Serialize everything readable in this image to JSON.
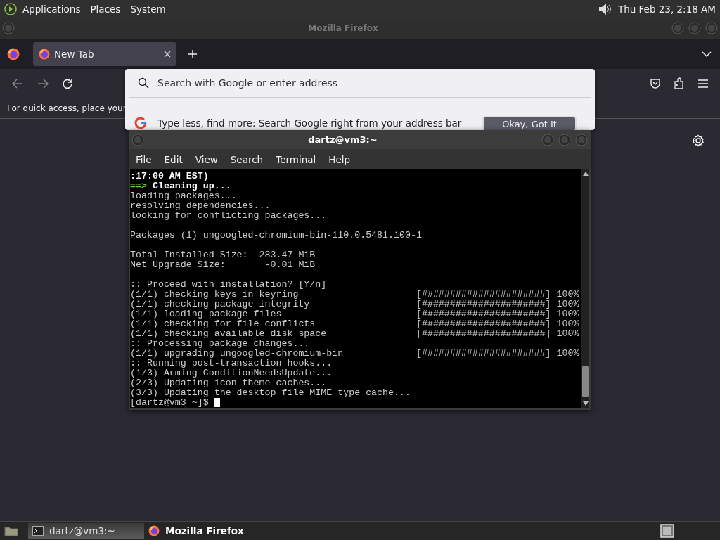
{
  "top_panel": {
    "menus": [
      "Applications",
      "Places",
      "System"
    ],
    "clock": "Thu Feb 23,  2:18 AM"
  },
  "firefox": {
    "title": "Mozilla Firefox",
    "tabs": [
      {
        "label": "New Tab",
        "selected": true
      }
    ],
    "bookmarks_hint": "For quick access, place your",
    "url_dropdown": {
      "placeholder": "Search with Google or enter address",
      "suggestion": "Type less, find more: Search Google right from your address bar",
      "button": "Okay, Got It"
    }
  },
  "terminal": {
    "title": "dartz@vm3:~",
    "menus": [
      "File",
      "Edit",
      "View",
      "Search",
      "Terminal",
      "Help"
    ],
    "lines": [
      {
        "kind": "bold",
        "text": ":17:00 AM EST)"
      },
      {
        "kind": "step",
        "arrow": "==>",
        "text": "Cleaning up..."
      },
      {
        "kind": "plain",
        "text": "loading packages..."
      },
      {
        "kind": "plain",
        "text": "resolving dependencies..."
      },
      {
        "kind": "plain",
        "text": "looking for conflicting packages..."
      },
      {
        "kind": "blank"
      },
      {
        "kind": "plain",
        "text": "Packages (1) ungoogled-chromium-bin-110.0.5481.100-1"
      },
      {
        "kind": "blank"
      },
      {
        "kind": "plain",
        "text": "Total Installed Size:  283.47 MiB"
      },
      {
        "kind": "plain",
        "text": "Net Upgrade Size:       -0.01 MiB"
      },
      {
        "kind": "blank"
      },
      {
        "kind": "plain",
        "text": ":: Proceed with installation? [Y/n]"
      },
      {
        "kind": "progress",
        "text": "(1/1) checking keys in keyring",
        "bar": "[######################]",
        "percent": "100%"
      },
      {
        "kind": "progress",
        "text": "(1/1) checking package integrity",
        "bar": "[######################]",
        "percent": "100%"
      },
      {
        "kind": "progress",
        "text": "(1/1) loading package files",
        "bar": "[######################]",
        "percent": "100%"
      },
      {
        "kind": "progress",
        "text": "(1/1) checking for file conflicts",
        "bar": "[######################]",
        "percent": "100%"
      },
      {
        "kind": "progress",
        "text": "(1/1) checking available disk space",
        "bar": "[######################]",
        "percent": "100%"
      },
      {
        "kind": "plain",
        "text": ":: Processing package changes..."
      },
      {
        "kind": "progress",
        "text": "(1/1) upgrading ungoogled-chromium-bin",
        "bar": "[######################]",
        "percent": "100%"
      },
      {
        "kind": "plain",
        "text": ":: Running post-transaction hooks..."
      },
      {
        "kind": "plain",
        "text": "(1/3) Arming ConditionNeedsUpdate..."
      },
      {
        "kind": "plain",
        "text": "(2/3) Updating icon theme caches..."
      },
      {
        "kind": "plain",
        "text": "(3/3) Updating the desktop file MIME type cache..."
      }
    ],
    "prompt": "[dartz@vm3 ~]$"
  },
  "taskbar": {
    "tasks": [
      {
        "kind": "terminal",
        "label": "dartz@vm3:~",
        "selected": true
      },
      {
        "kind": "firefox",
        "label": "Mozilla Firefox",
        "selected": false
      }
    ]
  }
}
